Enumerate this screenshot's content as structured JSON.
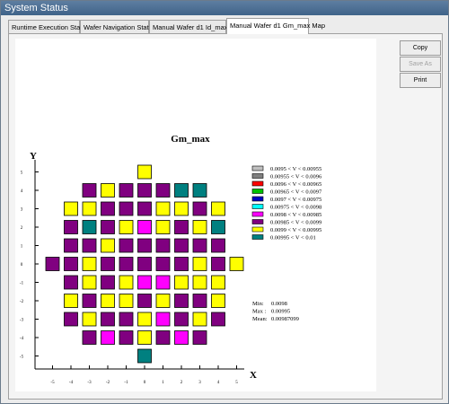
{
  "window": {
    "title": "System Status"
  },
  "tabs": [
    {
      "label": "Runtime Execution Status"
    },
    {
      "label": "Wafer Navigation Status"
    },
    {
      "label": "Manual Wafer d1 Id_max Map"
    },
    {
      "label": "Manual Wafer d1 Gm_max Map"
    }
  ],
  "buttons": {
    "copy": "Copy",
    "save_as": "Save As",
    "print": "Print"
  },
  "map": {
    "title": "Gm_max",
    "y_axis_label": "Y",
    "x_axis_label": "X",
    "x_ticks": [
      "-5",
      "-4",
      "-3",
      "-2",
      "-1",
      "0",
      "1",
      "2",
      "3",
      "4",
      "5"
    ],
    "y_ticks": [
      "5",
      "4",
      "3",
      "2",
      "1",
      "0",
      "-1",
      "-2",
      "-3",
      "-4",
      "-5"
    ],
    "legend": [
      {
        "label": "0.0095 < V < 0.00955",
        "color": "#c0c0c0"
      },
      {
        "label": "0.00955 < V < 0.0096",
        "color": "#808080"
      },
      {
        "label": "0.0096 < V < 0.00965",
        "color": "#ff0000"
      },
      {
        "label": "0.00965 < V < 0.0097",
        "color": "#00c000"
      },
      {
        "label": "0.0097 < V < 0.00975",
        "color": "#0000c0"
      },
      {
        "label": "0.00975 < V < 0.0098",
        "color": "#00ffff"
      },
      {
        "label": "0.0098 < V < 0.00985",
        "color": "#ff00ff"
      },
      {
        "label": "0.00985 < V < 0.0099",
        "color": "#800080"
      },
      {
        "label": "0.0099 < V < 0.00995",
        "color": "#ffff00"
      },
      {
        "label": "0.00995 < V < 0.01",
        "color": "#008080"
      }
    ],
    "stats": [
      {
        "label": "Min:",
        "value": "0.0098"
      },
      {
        "label": "Max :",
        "value": "0.00995"
      },
      {
        "label": "Mean:",
        "value": "0.00987099"
      }
    ],
    "rows": [
      {
        "y": 5,
        "cells": [
          {
            "x": 0,
            "c": 9
          }
        ]
      },
      {
        "y": 4,
        "cells": [
          {
            "x": -3,
            "c": 8
          },
          {
            "x": -2,
            "c": 9
          },
          {
            "x": -1,
            "c": 8
          },
          {
            "x": 0,
            "c": 8
          },
          {
            "x": 1,
            "c": 8
          },
          {
            "x": 2,
            "c": 10
          },
          {
            "x": 3,
            "c": 10
          }
        ]
      },
      {
        "y": 3,
        "cells": [
          {
            "x": -4,
            "c": 9
          },
          {
            "x": -3,
            "c": 9
          },
          {
            "x": -2,
            "c": 8
          },
          {
            "x": -1,
            "c": 8
          },
          {
            "x": 0,
            "c": 8
          },
          {
            "x": 1,
            "c": 9
          },
          {
            "x": 2,
            "c": 9
          },
          {
            "x": 3,
            "c": 8
          },
          {
            "x": 4,
            "c": 9
          }
        ]
      },
      {
        "y": 2,
        "cells": [
          {
            "x": -4,
            "c": 8
          },
          {
            "x": -3,
            "c": 10
          },
          {
            "x": -2,
            "c": 8
          },
          {
            "x": -1,
            "c": 9
          },
          {
            "x": 0,
            "c": 7
          },
          {
            "x": 1,
            "c": 9
          },
          {
            "x": 2,
            "c": 8
          },
          {
            "x": 3,
            "c": 9
          },
          {
            "x": 4,
            "c": 10
          }
        ]
      },
      {
        "y": 1,
        "cells": [
          {
            "x": -4,
            "c": 8
          },
          {
            "x": -3,
            "c": 8
          },
          {
            "x": -2,
            "c": 9
          },
          {
            "x": -1,
            "c": 8
          },
          {
            "x": 0,
            "c": 8
          },
          {
            "x": 1,
            "c": 8
          },
          {
            "x": 2,
            "c": 8
          },
          {
            "x": 3,
            "c": 8
          },
          {
            "x": 4,
            "c": 8
          }
        ]
      },
      {
        "y": 0,
        "cells": [
          {
            "x": -5,
            "c": 8
          },
          {
            "x": -4,
            "c": 8
          },
          {
            "x": -3,
            "c": 9
          },
          {
            "x": -2,
            "c": 8
          },
          {
            "x": -1,
            "c": 8
          },
          {
            "x": 0,
            "c": 8
          },
          {
            "x": 1,
            "c": 8
          },
          {
            "x": 2,
            "c": 8
          },
          {
            "x": 3,
            "c": 9
          },
          {
            "x": 4,
            "c": 8
          },
          {
            "x": 5,
            "c": 9
          }
        ]
      },
      {
        "y": -1,
        "cells": [
          {
            "x": -4,
            "c": 8
          },
          {
            "x": -3,
            "c": 9
          },
          {
            "x": -2,
            "c": 8
          },
          {
            "x": -1,
            "c": 9
          },
          {
            "x": 0,
            "c": 7
          },
          {
            "x": 1,
            "c": 7
          },
          {
            "x": 2,
            "c": 9
          },
          {
            "x": 3,
            "c": 9
          },
          {
            "x": 4,
            "c": 9
          }
        ]
      },
      {
        "y": -2,
        "cells": [
          {
            "x": -4,
            "c": 9
          },
          {
            "x": -3,
            "c": 8
          },
          {
            "x": -2,
            "c": 9
          },
          {
            "x": -1,
            "c": 9
          },
          {
            "x": 0,
            "c": 8
          },
          {
            "x": 1,
            "c": 9
          },
          {
            "x": 2,
            "c": 8
          },
          {
            "x": 3,
            "c": 8
          },
          {
            "x": 4,
            "c": 9
          }
        ]
      },
      {
        "y": -3,
        "cells": [
          {
            "x": -4,
            "c": 8
          },
          {
            "x": -3,
            "c": 9
          },
          {
            "x": -2,
            "c": 8
          },
          {
            "x": -1,
            "c": 8
          },
          {
            "x": 0,
            "c": 9
          },
          {
            "x": 1,
            "c": 7
          },
          {
            "x": 2,
            "c": 8
          },
          {
            "x": 3,
            "c": 9
          },
          {
            "x": 4,
            "c": 8
          }
        ]
      },
      {
        "y": -4,
        "cells": [
          {
            "x": -3,
            "c": 8
          },
          {
            "x": -2,
            "c": 7
          },
          {
            "x": -1,
            "c": 8
          },
          {
            "x": 0,
            "c": 9
          },
          {
            "x": 1,
            "c": 8
          },
          {
            "x": 2,
            "c": 7
          },
          {
            "x": 3,
            "c": 8
          }
        ]
      },
      {
        "y": -5,
        "cells": [
          {
            "x": 0,
            "c": 10
          }
        ]
      }
    ]
  }
}
